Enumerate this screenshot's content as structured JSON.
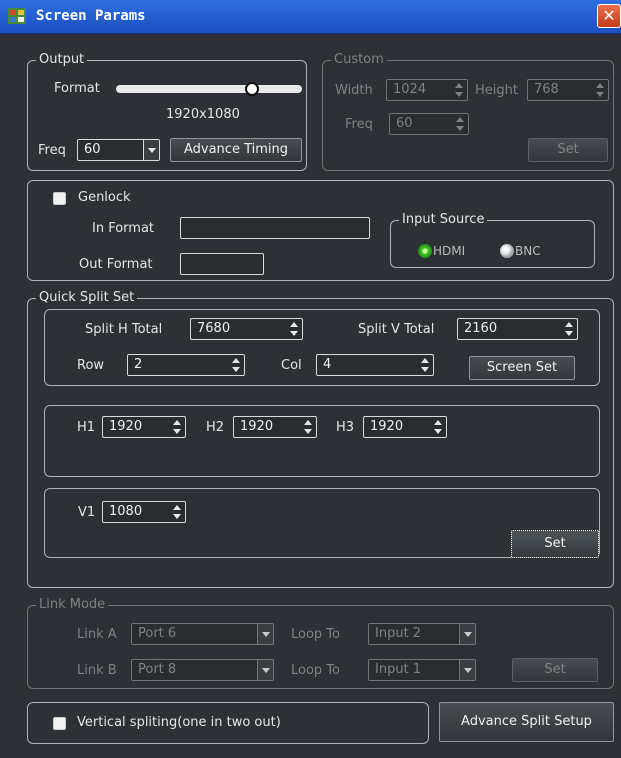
{
  "window": {
    "title": "Screen Params",
    "close_glyph": "✕"
  },
  "output": {
    "legend": "Output",
    "format_label": "Format",
    "format_level": 0.75,
    "resolution": "1920x1080",
    "freq_label": "Freq",
    "freq_value": "60",
    "advance_timing": "Advance Timing"
  },
  "custom": {
    "legend": "Custom",
    "width_label": "Width",
    "width_value": "1024",
    "height_label": "Height",
    "height_value": "768",
    "freq_label": "Freq",
    "freq_value": "60",
    "set": "Set"
  },
  "genlock": {
    "label": "Genlock",
    "checked": false,
    "in_format_label": "In Format",
    "in_format_value": "",
    "out_format_label": "Out Format",
    "out_format_value": "",
    "input_source": {
      "legend": "Input Source",
      "options": [
        "HDMI",
        "BNC"
      ],
      "selected": "HDMI"
    }
  },
  "quick_split": {
    "legend": "Quick Split Set",
    "split_h_label": "Split H Total",
    "split_h_value": "7680",
    "split_v_label": "Split V Total",
    "split_v_value": "2160",
    "row_label": "Row",
    "row_value": "2",
    "col_label": "Col",
    "col_value": "4",
    "screen_set": "Screen Set",
    "h_fields": [
      {
        "label": "H1",
        "value": "1920"
      },
      {
        "label": "H2",
        "value": "1920"
      },
      {
        "label": "H3",
        "value": "1920"
      }
    ],
    "v_fields": [
      {
        "label": "V1",
        "value": "1080"
      }
    ],
    "set": "Set"
  },
  "link_mode": {
    "legend": "Link Mode",
    "link_a_label": "Link A",
    "link_a_value": "Port 6",
    "link_a_loop_label": "Loop To",
    "link_a_loop_value": "Input 2",
    "link_b_label": "Link B",
    "link_b_value": "Port 8",
    "link_b_loop_label": "Loop To",
    "link_b_loop_value": "Input 1",
    "set": "Set"
  },
  "footer": {
    "vertical_split_label": "Vertical spliting(one in two out)",
    "vertical_split_checked": false,
    "advance_split_setup": "Advance Split Setup"
  },
  "colors": {
    "title_bar": "#2f6fe0",
    "background": "#2d3135",
    "radio_selected": "#47c92b",
    "close_button": "#c43b1a"
  }
}
